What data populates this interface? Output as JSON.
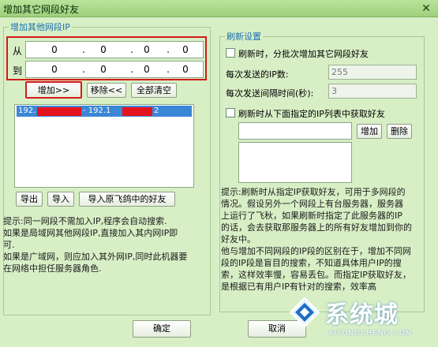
{
  "window": {
    "title": "增加其它网段好友",
    "close_glyph": "✕"
  },
  "left_group": {
    "legend": "增加其他网段IP",
    "from_label": "从",
    "to_label": "到",
    "from_ip": [
      "0",
      "0",
      "0",
      "0"
    ],
    "to_ip": [
      "0",
      "0",
      "0",
      "0"
    ],
    "dot": ".",
    "add_button": "增加>>",
    "remove_button": "移除<<",
    "clear_button": "全部清空",
    "list_row": {
      "start": "192.",
      "mid": " - 192.1",
      "end": "2"
    },
    "export_button": "导出",
    "import_button": "导入",
    "import_feige_button": "导入原飞鸽中的好友",
    "note": [
      "提示:同一网段不需加入IP,程序会自动搜索.",
      "如果是局域网其他网段IP,直接加入其内网IP即",
      "可.",
      "如果是广域网，则应加入其外网IP,同时此机器要",
      "在网络中担任服务器角色."
    ]
  },
  "right_group": {
    "legend": "刷新设置",
    "batch_checkbox_label": "刷新时，分批次增加其它网段好友",
    "ips_per_send_label": "每次发送的IP数:",
    "ips_per_send_value": "255",
    "interval_label": "每次发送间隔时间(秒):",
    "interval_value": "3",
    "list_checkbox_label": "刷新时从下面指定的IP列表中获取好友",
    "add_button": "增加",
    "delete_button": "删除",
    "note": [
      "提示:刷新时从指定IP获取好友，可用于多网段的",
      "情况。假设另外一个网段上有台服务器，服务器",
      "上运行了飞秋，如果刷新时指定了此服务器的IP",
      "的话，会去获取那服务器上的所有好友增加到你的",
      "好友中。",
      "他与增加不同网段的IP段的区别在于，增加不同网",
      "段的IP段是盲目的搜索，不知道具体用户IP的搜",
      "索，这样效率慢，容易丢包。而指定IP获取好友，",
      "是根据已有用户IP有针对的搜索，效率高"
    ]
  },
  "footer": {
    "ok_button": "确定",
    "cancel_button": "取消"
  },
  "watermark": {
    "text": "系统城",
    "url": "XITONGCHENG.COM"
  },
  "colors": {
    "window_bg": "#d8efc6",
    "highlight_red": "#d31a1a",
    "selection_blue": "#3c86d6",
    "legend_blue": "#1b6fb0"
  }
}
